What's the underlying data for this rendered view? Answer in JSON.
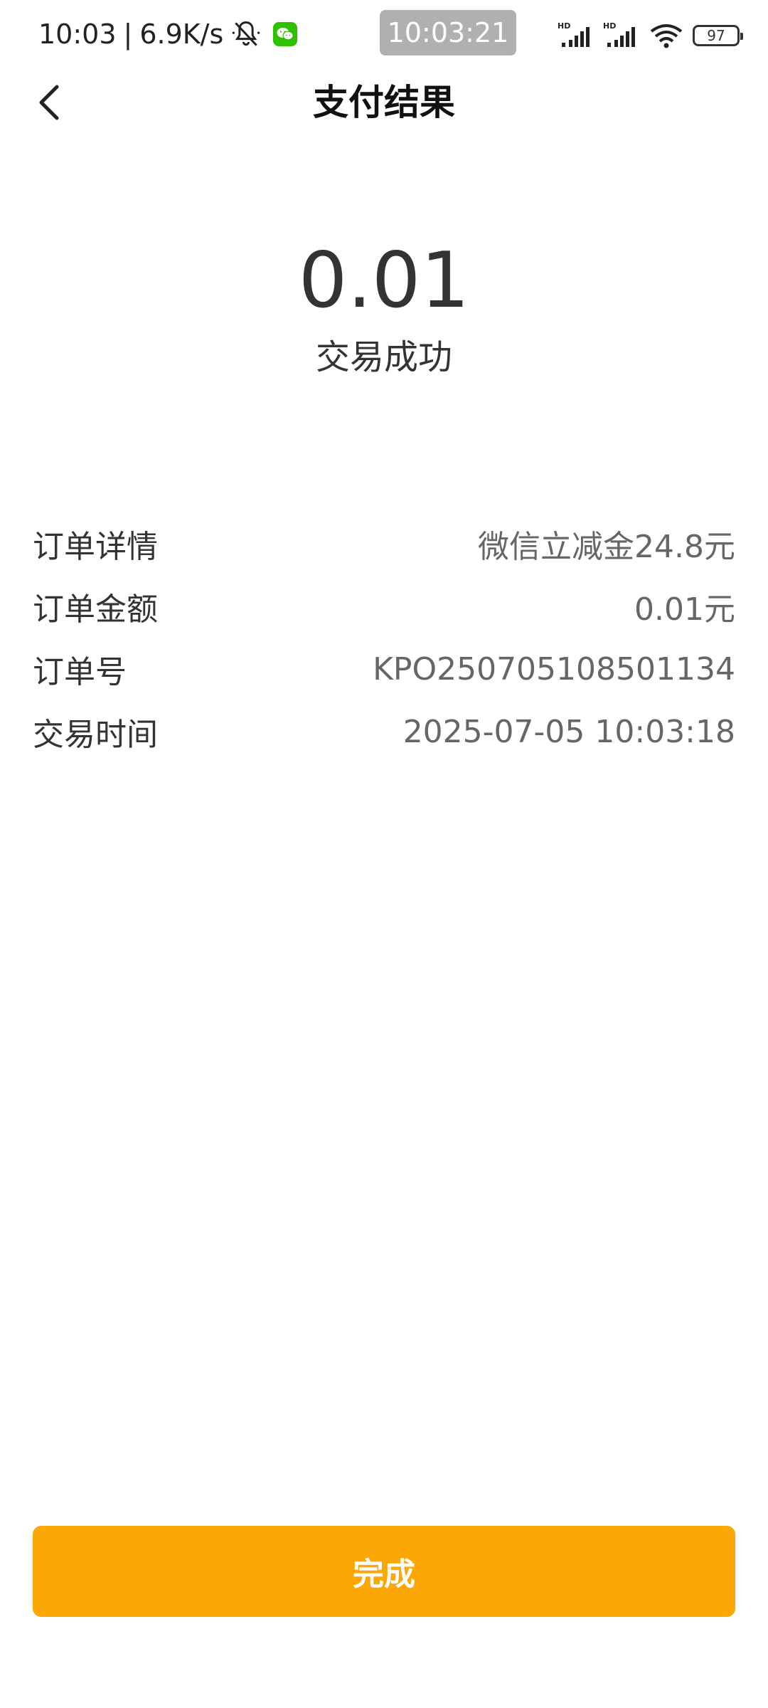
{
  "status_bar": {
    "time": "10:03",
    "separator": "|",
    "network_speed": "6.9K/s",
    "clock_overlay": "10:03:21",
    "signal_1_label": "HD",
    "signal_2_label": "HD",
    "battery_level": "97",
    "icons": [
      "mute-bell-icon",
      "wechat-icon",
      "signal-icon",
      "wifi-icon",
      "battery-icon"
    ]
  },
  "header": {
    "title": "支付结果",
    "back_icon": "chevron-left-icon"
  },
  "result": {
    "amount": "0.01",
    "status": "交易成功"
  },
  "details": [
    {
      "label": "订单详情",
      "value": "微信立减金24.8元"
    },
    {
      "label": "订单金额",
      "value": "0.01元"
    },
    {
      "label": "订单号",
      "value": "KPO250705108501134"
    },
    {
      "label": "交易时间",
      "value": "2025-07-05 10:03:18"
    }
  ],
  "footer": {
    "done_label": "完成"
  },
  "colors": {
    "accent": "#fba705",
    "wechat_green": "#2dc100"
  }
}
